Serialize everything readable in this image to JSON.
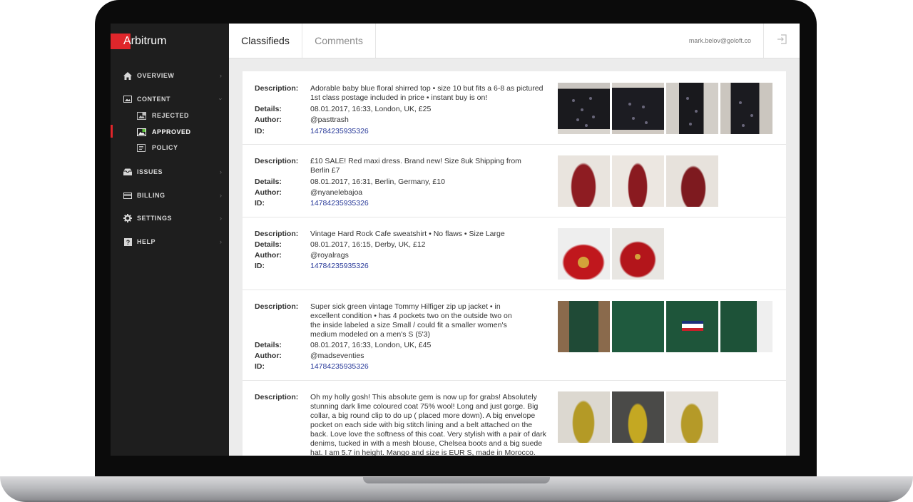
{
  "app": {
    "logo_text": "Arbitrum"
  },
  "sidebar": {
    "items": [
      {
        "label": "OVERVIEW",
        "icon": "home-icon"
      },
      {
        "label": "CONTENT",
        "icon": "image-icon"
      },
      {
        "label": "REJECTED",
        "icon": "rejected-image-icon"
      },
      {
        "label": "APPROVED",
        "icon": "approved-image-icon"
      },
      {
        "label": "POLICY",
        "icon": "document-icon"
      },
      {
        "label": "ISSUES",
        "icon": "inbox-icon"
      },
      {
        "label": "BILLING",
        "icon": "credit-card-icon"
      },
      {
        "label": "SETTINGS",
        "icon": "gear-icon"
      },
      {
        "label": "HELP",
        "icon": "question-icon"
      }
    ],
    "active": "APPROVED",
    "accent": "#e0262b"
  },
  "header": {
    "tabs": [
      "Classifieds",
      "Comments"
    ],
    "active_tab": "Classifieds",
    "user_email": "mark.belov@goloft.co"
  },
  "labels": {
    "description": "Description:",
    "details": "Details:",
    "author": "Author:",
    "id": "ID:"
  },
  "listings": [
    {
      "description": "Adorable baby blue floral shirred top • size 10 but fits a 6-8 as pictured 1st class postage included in price • instant buy is on!",
      "details": "08.01.2017, 16:33, London, UK, £25",
      "author": "@pasttrash",
      "id": "14784235935326",
      "photos": [
        "black floral trousers front",
        "black floral trousers back",
        "black floral trousers side",
        "black floral trousers pose"
      ]
    },
    {
      "description": "£10 SALE! Red maxi dress. Brand new! Size 8uk Shipping from Berlin £7",
      "details": "08.01.2017, 16:31, Berlin, Germany, £10",
      "author": "@nyanelebajoa",
      "id": "14784235935326",
      "photos": [
        "red maxi dress front",
        "red maxi dress side",
        "red maxi dress back"
      ]
    },
    {
      "description": "Vintage Hard Rock Cafe sweatshirt • No flaws • Size Large",
      "details": "08.01.2017, 16:15, Derby, UK, £12",
      "author": "@royalrags",
      "id": "14784235935326",
      "photos": [
        "red sweatshirt front",
        "red sweatshirt hanging"
      ]
    },
    {
      "description": "Super sick green vintage Tommy Hilfiger zip up jacket • in excellent condition • has 4 pockets two on the outside two on the inside labeled a size Small / could fit a smaller women's medium modeled on a men's S (5'3)",
      "details": "08.01.2017, 16:33, London, UK, £45",
      "author": "@madseventies",
      "id": "14784235935326",
      "photos": [
        "green jacket worn",
        "green jacket collar",
        "green jacket logo",
        "green jacket detail"
      ]
    },
    {
      "description": "Oh my holly gosh! This absolute gem is now up for grabs! Absolutely stunning dark lime coloured coat 75% wool! Long and just gorge. Big collar, a big round clip to do up ( placed more down). A big envelope pocket on each side with big stitch lining and a belt attached on the back. Love love the softness of this coat. Very stylish with a pair of dark denims, tucked in with a mesh blouse, Chelsea boots and a big suede hat. I am 5.7 in height. Mango and size is EUR S, made in Morocco. Postage included within UK. @depop #woolcoat #coat #winter",
      "photos": [
        "lime coat front",
        "lime coat side",
        "lime coat hat"
      ]
    }
  ]
}
